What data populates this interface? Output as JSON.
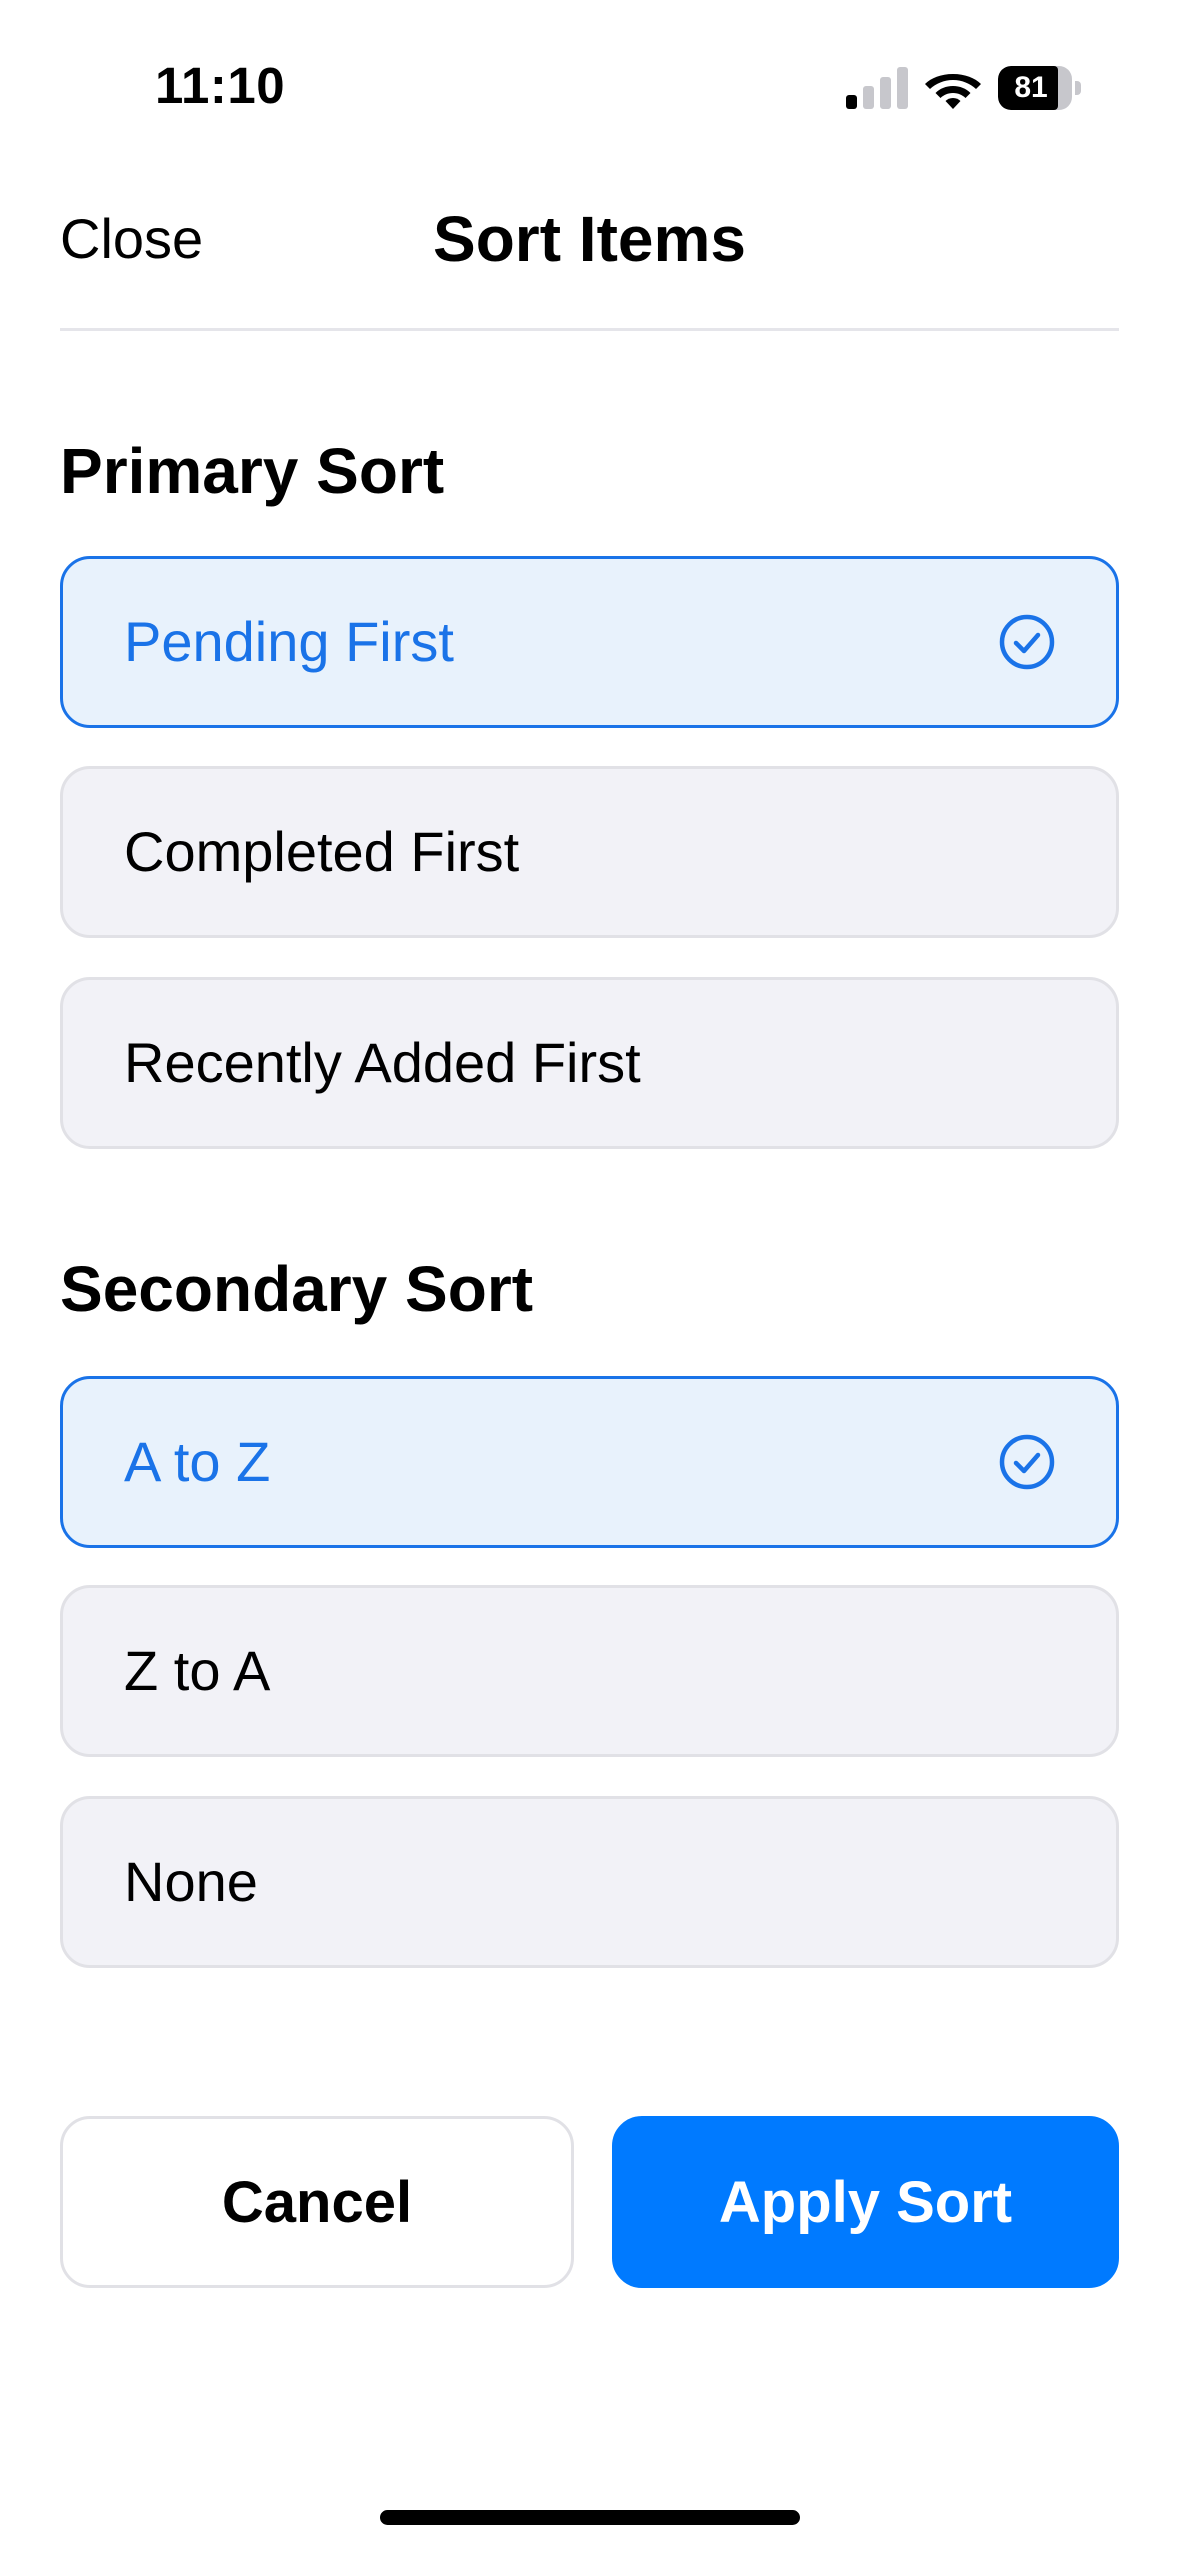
{
  "status_bar": {
    "time": "11:10",
    "battery_level": "81",
    "battery_fraction": 0.81,
    "signal_bars_active": 1,
    "signal_bars_total": 4
  },
  "header": {
    "close_label": "Close",
    "title": "Sort Items"
  },
  "primary_sort": {
    "title": "Primary Sort",
    "options": [
      {
        "label": "Pending First",
        "selected": true
      },
      {
        "label": "Completed First",
        "selected": false
      },
      {
        "label": "Recently Added First",
        "selected": false
      }
    ]
  },
  "secondary_sort": {
    "title": "Secondary Sort",
    "options": [
      {
        "label": "A to Z",
        "selected": true
      },
      {
        "label": "Z to A",
        "selected": false
      },
      {
        "label": "None",
        "selected": false
      }
    ]
  },
  "actions": {
    "cancel_label": "Cancel",
    "apply_label": "Apply Sort"
  },
  "colors": {
    "accent": "#007aff",
    "selected_text": "#1a73e8",
    "selected_bg": "#e8f2fc",
    "option_bg": "#f2f2f7"
  },
  "icons": {
    "check": "checkmark-circle-icon",
    "signal": "cellular-signal-icon",
    "wifi": "wifi-icon",
    "battery": "battery-icon"
  }
}
